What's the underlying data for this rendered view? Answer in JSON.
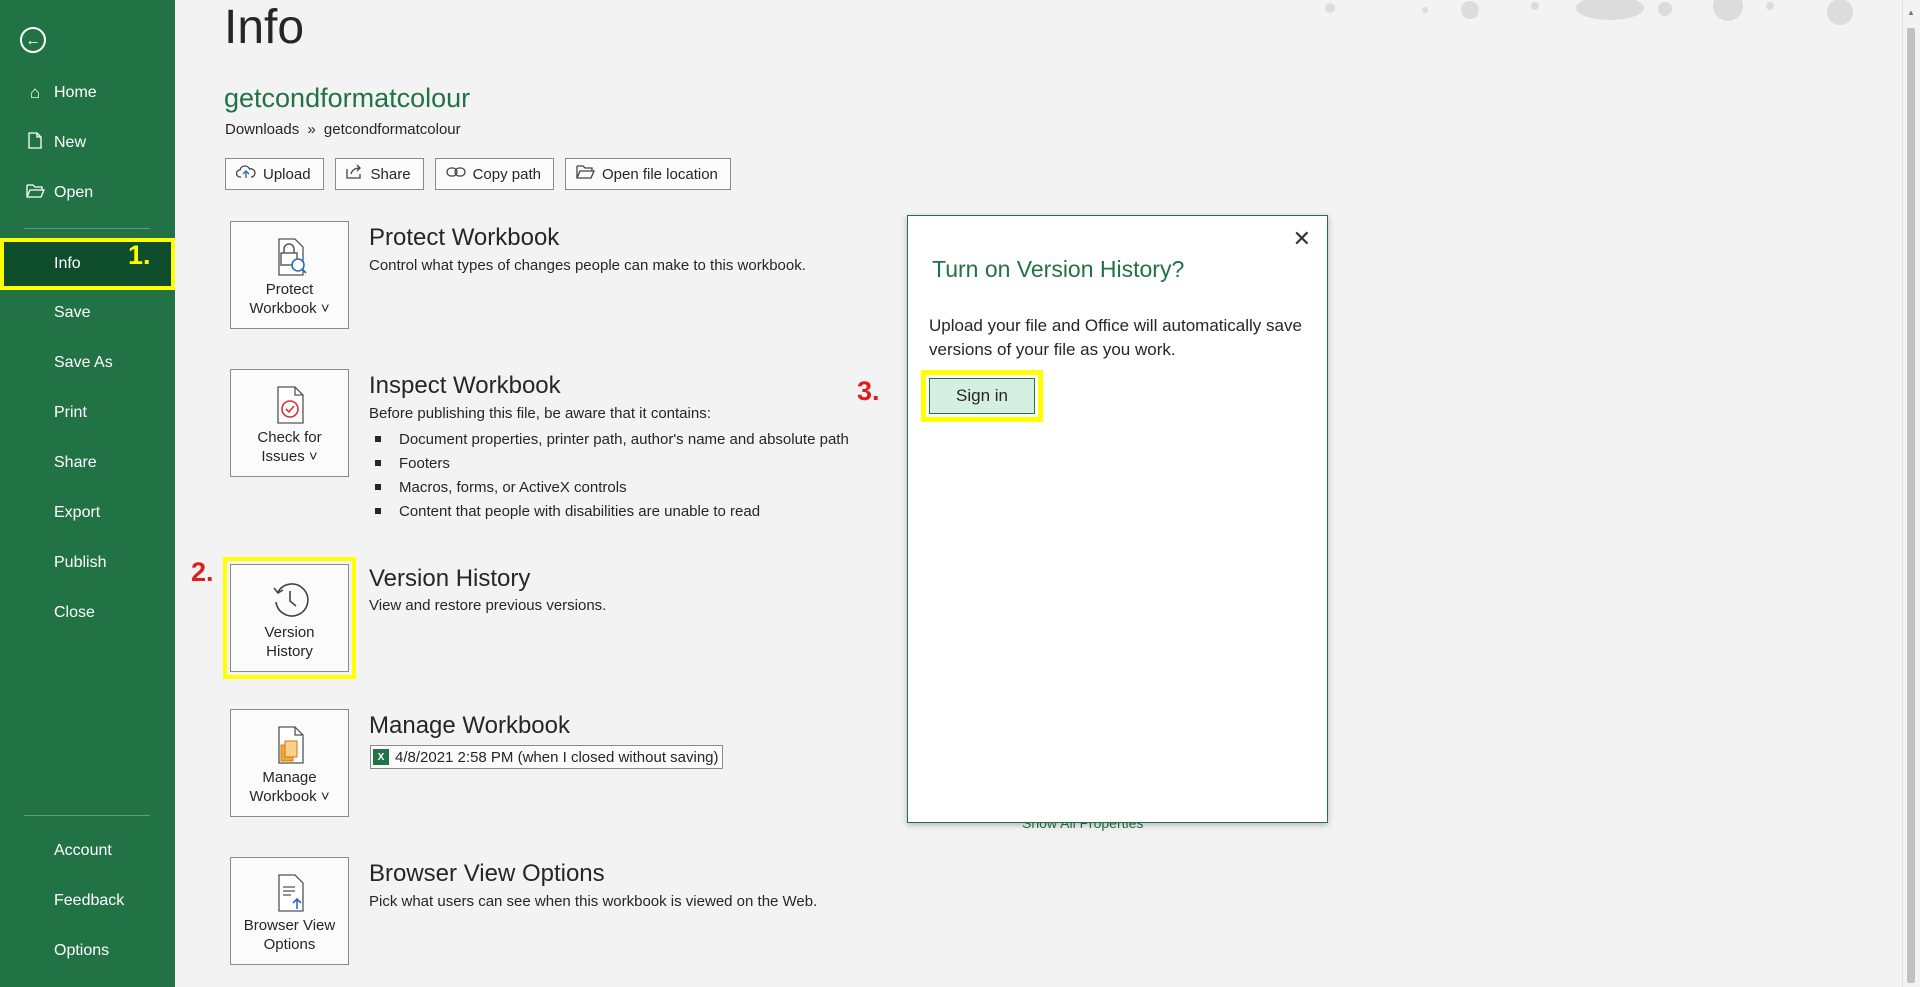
{
  "sidebar": {
    "back_icon": "back-arrow-icon",
    "top_items": [
      {
        "label": "Home",
        "icon": "home-icon"
      },
      {
        "label": "New",
        "icon": "new-document-icon"
      },
      {
        "label": "Open",
        "icon": "folder-open-icon"
      }
    ],
    "middle_items": [
      "Info",
      "Save",
      "Save As",
      "Print",
      "Share",
      "Export",
      "Publish",
      "Close"
    ],
    "bottom_items": [
      "Account",
      "Feedback",
      "Options"
    ],
    "active_item": "Info"
  },
  "annotations": {
    "step1": "1.",
    "step2": "2.",
    "step3": "3."
  },
  "page": {
    "title": "Info",
    "file_name": "getcondformatcolour",
    "path_folder": "Downloads",
    "path_sep": "»",
    "path_file": "getcondformatcolour"
  },
  "toolbar": {
    "upload": "Upload",
    "share": "Share",
    "copy_path": "Copy path",
    "open_location": "Open file location"
  },
  "sections": {
    "protect": {
      "btn_line1": "Protect",
      "btn_line2": "Workbook ˅",
      "title": "Protect Workbook",
      "desc": "Control what types of changes people can make to this workbook."
    },
    "inspect": {
      "btn_line1": "Check for",
      "btn_line2": "Issues ˅",
      "title": "Inspect Workbook",
      "desc": "Before publishing this file, be aware that it contains:",
      "bullets": [
        "Document properties, printer path, author's name and absolute path",
        "Footers",
        "Macros, forms, or ActiveX controls",
        "Content that people with disabilities are unable to read"
      ]
    },
    "version": {
      "btn_line1": "Version",
      "btn_line2": "History",
      "title": "Version History",
      "desc": "View and restore previous versions."
    },
    "manage": {
      "btn_line1": "Manage",
      "btn_line2": "Workbook ˅",
      "title": "Manage Workbook",
      "unsaved": "4/8/2021 2:58 PM (when I closed without saving)"
    },
    "browser": {
      "btn_line1": "Browser View",
      "btn_line2": "Options",
      "title": "Browser View Options",
      "desc": "Pick what users can see when this workbook is viewed on the Web."
    }
  },
  "properties_link": "Show All Properties",
  "popup": {
    "title": "Turn on Version History?",
    "body": "Upload your file and Office will automatically save versions of your file as you work.",
    "sign_in": "Sign in"
  },
  "colors": {
    "brand": "#217346",
    "highlight": "#ffff00",
    "annotation_red": "#e01c1c"
  }
}
